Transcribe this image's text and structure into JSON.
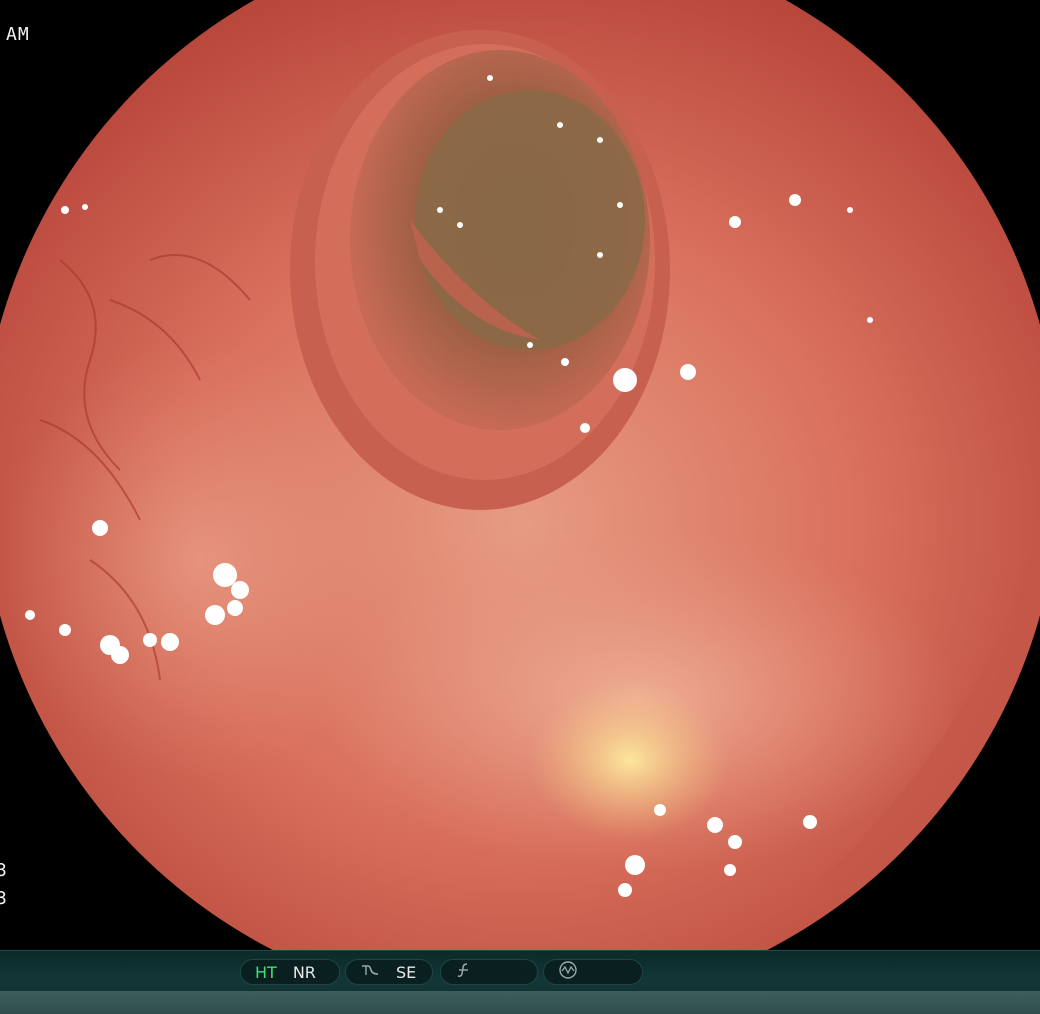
{
  "overlay": {
    "top_left": "AM",
    "left_small_1": "3",
    "left_small_2": "3"
  },
  "status_bar": {
    "ht": "HT",
    "nr": "NR",
    "se": "SE",
    "ht_color": "#3ee07a"
  },
  "icons": {
    "pill_2": "curve-icon",
    "pill_3": "function-icon",
    "pill_4": "waveform-icon"
  }
}
